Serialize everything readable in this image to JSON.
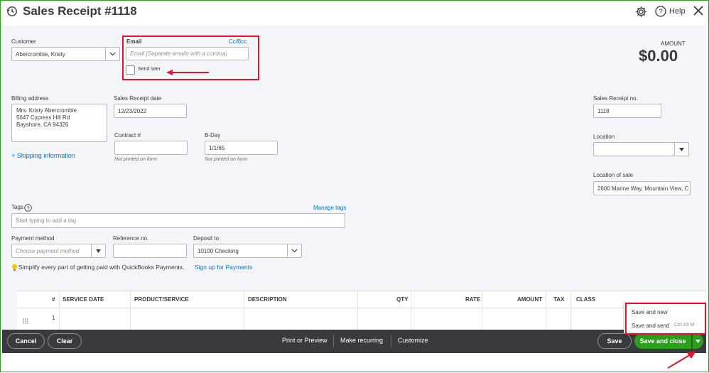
{
  "header": {
    "title": "Sales Receipt #1118",
    "help_label": "Help"
  },
  "customer": {
    "label": "Customer",
    "value": "Abercrombie, Kristy"
  },
  "email": {
    "label": "Email",
    "ccbcc_label": "Cc/Bcc",
    "placeholder": "Email (Separate emails with a comma)",
    "send_later_label": "Send later",
    "send_later_checked": false
  },
  "amount": {
    "label": "AMOUNT",
    "value": "$0.00"
  },
  "billing": {
    "label": "Billing address",
    "lines": [
      "Mrs. Kristy Abercrombie",
      "5647 Cypress Hill Rd",
      "Bayshore, CA  94326"
    ],
    "shipping_link": "+ Shipping information"
  },
  "receipt_date": {
    "label": "Sales Receipt date",
    "value": "12/23/2022"
  },
  "contract": {
    "label": "Contract #",
    "value": "",
    "note": "Not printed on form"
  },
  "bday": {
    "label": "B-Day",
    "value": "1/1/65",
    "note": "Not printed on form"
  },
  "receipt_no": {
    "label": "Sales Receipt no.",
    "value": "1118"
  },
  "location": {
    "label": "Location",
    "value": ""
  },
  "location_of_sale": {
    "label": "Location of sale",
    "value": "2600 Marine Way, Mountain View, C"
  },
  "tags": {
    "label": "Tags",
    "manage_link": "Manage tags",
    "placeholder": "Start typing to add a tag"
  },
  "payment_method": {
    "label": "Payment method",
    "placeholder": "Choose payment method"
  },
  "reference": {
    "label": "Reference no.",
    "value": ""
  },
  "deposit": {
    "label": "Deposit to",
    "value": "10100 Checking"
  },
  "promo": {
    "text": "Simplify every part of getting paid with QuickBooks Payments.",
    "link": "Sign up for Payments"
  },
  "table": {
    "headers": [
      "#",
      "SERVICE DATE",
      "PRODUCT/SERVICE",
      "DESCRIPTION",
      "QTY",
      "RATE",
      "AMOUNT",
      "TAX",
      "CLASS"
    ],
    "rows": [
      {
        "num": "1"
      }
    ]
  },
  "footer": {
    "cancel": "Cancel",
    "clear": "Clear",
    "print_preview": "Print or Preview",
    "make_recurring": "Make recurring",
    "customize": "Customize",
    "save": "Save",
    "save_and_close": "Save and close"
  },
  "save_menu": {
    "items": [
      {
        "label": "Save and new",
        "shortcut": ""
      },
      {
        "label": "Save and send",
        "shortcut": "Ctrl Alt M"
      }
    ]
  },
  "colors": {
    "accent_green": "#2ca01c",
    "link_blue": "#0077c5",
    "annotation_red": "#e0142d",
    "footer_dark": "#393a3d"
  }
}
